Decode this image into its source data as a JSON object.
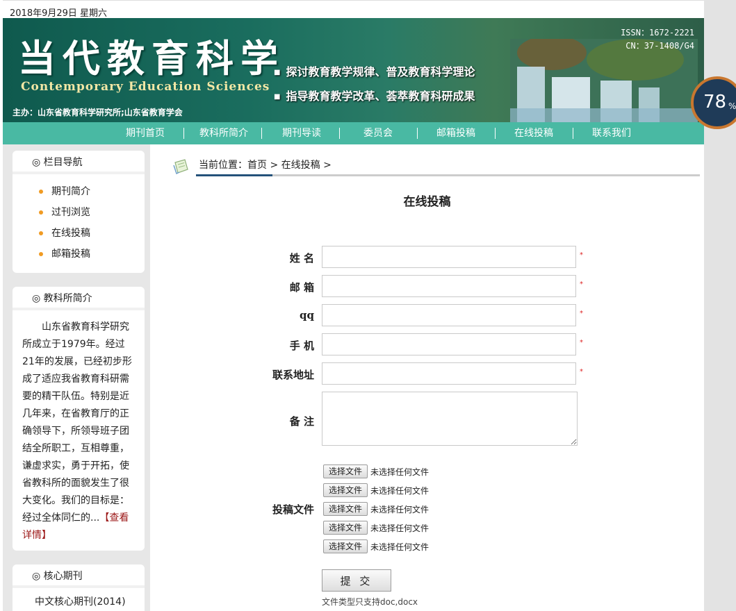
{
  "date": "2018年9月29日 星期六",
  "banner": {
    "title_cn": "当代教育科学",
    "title_en": "Contemporary Education Sciences",
    "sponsor": "主办：山东省教育科学研究所;山东省教育学会",
    "slogan1": "探讨教育教学规律、普及教育科学理论",
    "slogan2": "指导教育教学改革、荟萃教育科研成果",
    "issn": "ISSN：1672-2221",
    "cn": "CN：37-1408/G4"
  },
  "nav": [
    "期刊首页",
    "教科所简介",
    "期刊导读",
    "委员会",
    "邮箱投稿",
    "在线投稿",
    "联系我们"
  ],
  "sidebar": {
    "column_nav": {
      "title": "◎ 栏目导航",
      "items": [
        "期刊简介",
        "过刊浏览",
        "在线投稿",
        "邮箱投稿"
      ]
    },
    "intro": {
      "title": "◎ 教科所简介",
      "text": "山东省教育科学研究所成立于1979年。经过21年的发展，已经初步形成了适应我省教育科研需要的精干队伍。特别是近几年来，在省教育厅的正确领导下，所领导班子团结全所职工，互相尊重，谦虚求实，勇于开拓，使省教科所的面貌发生了很大变化。我们的目标是：经过全体同仁的...",
      "more": "【查看详情】"
    },
    "core": {
      "title": "◎ 核心期刊",
      "first_item": "中文核心期刊(2014)"
    }
  },
  "breadcrumb": "当前位置：首页 > 在线投稿 >",
  "form": {
    "title": "在线投稿",
    "labels": {
      "name": "姓 名",
      "email": "邮 箱",
      "qq": "qq",
      "phone": "手 机",
      "address": "联系地址",
      "note": "备 注",
      "files": "投稿文件"
    },
    "required_mark": "*",
    "file_button": "选择文件",
    "file_status": "未选择任何文件",
    "submit": "提 交",
    "file_note": "文件类型只支持doc,docx"
  },
  "progress_badge": {
    "value": "78",
    "unit": "%"
  },
  "colors": {
    "nav_bg": "#49b9a3",
    "banner_bg": "#1a6d5e",
    "required": "#dd2222",
    "more_link": "#9b1616"
  }
}
